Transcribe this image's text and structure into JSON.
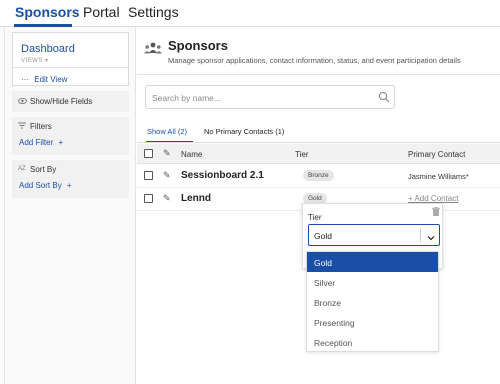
{
  "nav": {
    "tabs": [
      "Sponsors",
      "Portal",
      "Settings"
    ]
  },
  "sidebar": {
    "dashboard": "Dashboard",
    "views_label": "VIEWS ▾",
    "edit_view": "Edit View",
    "edit_icon": "···",
    "show_hide": "Show/Hide Fields",
    "filters_title": "Filters",
    "add_filter": "Add Filter",
    "sort_title": "Sort By",
    "add_sort": "Add Sort By",
    "sort_icon": "AZ"
  },
  "header": {
    "title": "Sponsors",
    "description": "Manage sponsor applications, contact information, status, and event participation details"
  },
  "search": {
    "placeholder": "Search by name..."
  },
  "tabs": [
    {
      "label": "Show All (2)"
    },
    {
      "label": "No Primary Contacts (1)"
    }
  ],
  "table": {
    "columns": [
      "Name",
      "Tier",
      "Primary Contact"
    ],
    "rows": [
      {
        "name": "Sessionboard 2.1",
        "tier": "Bronze",
        "contact": "Jasmine Williams*"
      },
      {
        "name": "Lennd",
        "tier": "Gold",
        "contact": "+ Add Contact"
      }
    ]
  },
  "tier_editor": {
    "label": "Tier",
    "selected": "Gold",
    "options": [
      "Gold",
      "Silver",
      "Bronze",
      "Presenting",
      "Reception"
    ]
  },
  "colors": {
    "accent": "#1a4fa8"
  }
}
